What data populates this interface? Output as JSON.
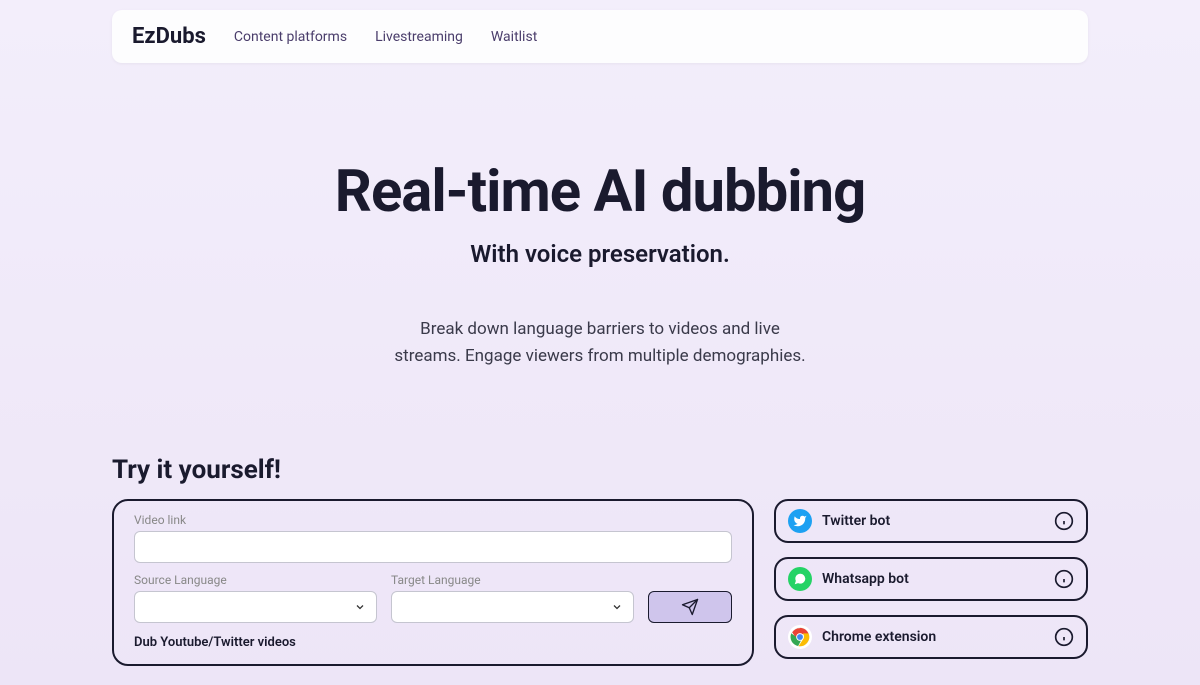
{
  "nav": {
    "brand": "EzDubs",
    "links": [
      "Content platforms",
      "Livestreaming",
      "Waitlist"
    ]
  },
  "hero": {
    "title": "Real-time AI dubbing",
    "subtitle": "With voice preservation.",
    "description_line1": "Break down language barriers to videos and live",
    "description_line2": "streams. Engage viewers from multiple demographies."
  },
  "try": {
    "heading": "Try it yourself!",
    "video_label": "Video link",
    "video_value": "",
    "source_label": "Source Language",
    "target_label": "Target Language",
    "caption": "Dub Youtube/Twitter videos"
  },
  "side": {
    "twitter": "Twitter bot",
    "whatsapp": "Whatsapp bot",
    "chrome": "Chrome extension"
  }
}
